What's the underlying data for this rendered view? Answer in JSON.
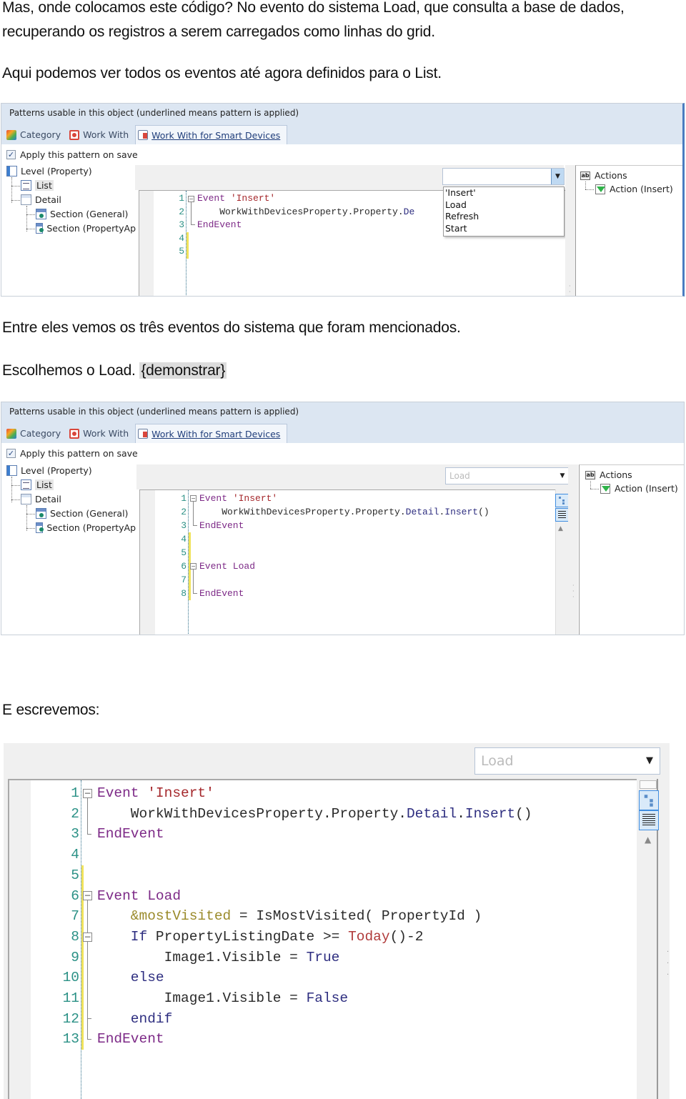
{
  "paragraphs": {
    "p1_line1": "Mas, onde colocamos este código? No evento do sistema Load, que consulta a base de dados,",
    "p1_line2": "recuperando os registros a serem carregados como linhas do grid.",
    "p2": "Aqui podemos ver todos os eventos até agora definidos para o List.",
    "p3": "Entre eles vemos os três eventos do sistema que foram mencionados.",
    "p4_text": "Escolhemos o Load.",
    "p4_highlight": "{demonstrar}",
    "p5": "E escrevemos:"
  },
  "pattern_panel": {
    "header": "Patterns usable in this object (underlined means pattern is applied)",
    "tabs": [
      {
        "label": "Category",
        "icon": "category-icon"
      },
      {
        "label": "Work With",
        "icon": "work-with-icon"
      },
      {
        "label": "Work With for Smart Devices",
        "icon": "work-with-smart-devices-icon",
        "active": true
      }
    ],
    "apply_checkbox": {
      "label": "Apply this pattern on save",
      "checked": true
    },
    "tree": [
      {
        "label": "Level (Property)",
        "icon": "level-icon"
      },
      {
        "label": "List",
        "icon": "list-icon",
        "selected": true
      },
      {
        "label": "Detail",
        "icon": "detail-icon"
      },
      {
        "label": "Section (General)",
        "icon": "section-icon"
      },
      {
        "label": "Section (PropertyAp",
        "icon": "section-icon"
      }
    ],
    "actions_tree": {
      "root": "Actions",
      "child": "Action (Insert)"
    }
  },
  "screenshot1": {
    "event_combo_value": "",
    "dropdown_options": [
      "'Insert'",
      "Load",
      "Refresh",
      "Start"
    ],
    "code": [
      {
        "n": "1",
        "tokens": [
          [
            "kw",
            "Event "
          ],
          [
            "str",
            "'Insert'"
          ]
        ]
      },
      {
        "n": "2",
        "tokens": [
          [
            "id",
            "    WorkWithDevicesProperty.Property."
          ],
          [
            "mem",
            "De"
          ]
        ]
      },
      {
        "n": "3",
        "tokens": [
          [
            "kw",
            "EndEvent"
          ]
        ]
      },
      {
        "n": "4",
        "tokens": []
      },
      {
        "n": "5",
        "tokens": []
      }
    ]
  },
  "screenshot2": {
    "event_combo_value": "Load",
    "code": [
      {
        "n": "1",
        "tokens": [
          [
            "kw",
            "Event "
          ],
          [
            "str",
            "'Insert'"
          ]
        ]
      },
      {
        "n": "2",
        "tokens": [
          [
            "id",
            "    WorkWithDevicesProperty.Property."
          ],
          [
            "mem",
            "Detail"
          ],
          [
            "id",
            "."
          ],
          [
            "mem",
            "Insert"
          ],
          [
            "id",
            "()"
          ]
        ]
      },
      {
        "n": "3",
        "tokens": [
          [
            "kw",
            "EndEvent"
          ]
        ]
      },
      {
        "n": "4",
        "tokens": []
      },
      {
        "n": "5",
        "tokens": []
      },
      {
        "n": "6",
        "tokens": [
          [
            "kw",
            "Event Load"
          ]
        ]
      },
      {
        "n": "7",
        "tokens": []
      },
      {
        "n": "8",
        "tokens": [
          [
            "kw",
            "EndEvent"
          ]
        ]
      }
    ]
  },
  "screenshot3": {
    "event_combo_value": "Load",
    "code": [
      {
        "n": "1",
        "tokens": [
          [
            "kw",
            "Event "
          ],
          [
            "str",
            "'Insert'"
          ]
        ]
      },
      {
        "n": "2",
        "tokens": [
          [
            "id",
            "    WorkWithDevicesProperty.Property."
          ],
          [
            "mem",
            "Detail"
          ],
          [
            "id",
            "."
          ],
          [
            "mem",
            "Insert"
          ],
          [
            "id",
            "()"
          ]
        ]
      },
      {
        "n": "3",
        "tokens": [
          [
            "kw",
            "EndEvent"
          ]
        ]
      },
      {
        "n": "4",
        "tokens": []
      },
      {
        "n": "5",
        "tokens": []
      },
      {
        "n": "6",
        "tokens": [
          [
            "kw",
            "Event Load"
          ]
        ]
      },
      {
        "n": "7",
        "tokens": [
          [
            "var",
            "    &mostVisited"
          ],
          [
            "id",
            " = IsMostVisited( PropertyId )"
          ]
        ]
      },
      {
        "n": "8",
        "tokens": [
          [
            "mem",
            "    If "
          ],
          [
            "id",
            "PropertyListingDate >= "
          ],
          [
            "fn",
            "Today"
          ],
          [
            "id",
            "()-2"
          ]
        ]
      },
      {
        "n": "9",
        "tokens": [
          [
            "id",
            "        Image1.Visible = "
          ],
          [
            "mem",
            "True"
          ]
        ]
      },
      {
        "n": "10",
        "tokens": [
          [
            "mem",
            "    else"
          ]
        ]
      },
      {
        "n": "11",
        "tokens": [
          [
            "id",
            "        Image1.Visible = "
          ],
          [
            "mem",
            "False"
          ]
        ]
      },
      {
        "n": "12",
        "tokens": [
          [
            "mem",
            "    endif"
          ]
        ]
      },
      {
        "n": "13",
        "tokens": [
          [
            "kw",
            "EndEvent"
          ]
        ]
      }
    ]
  }
}
